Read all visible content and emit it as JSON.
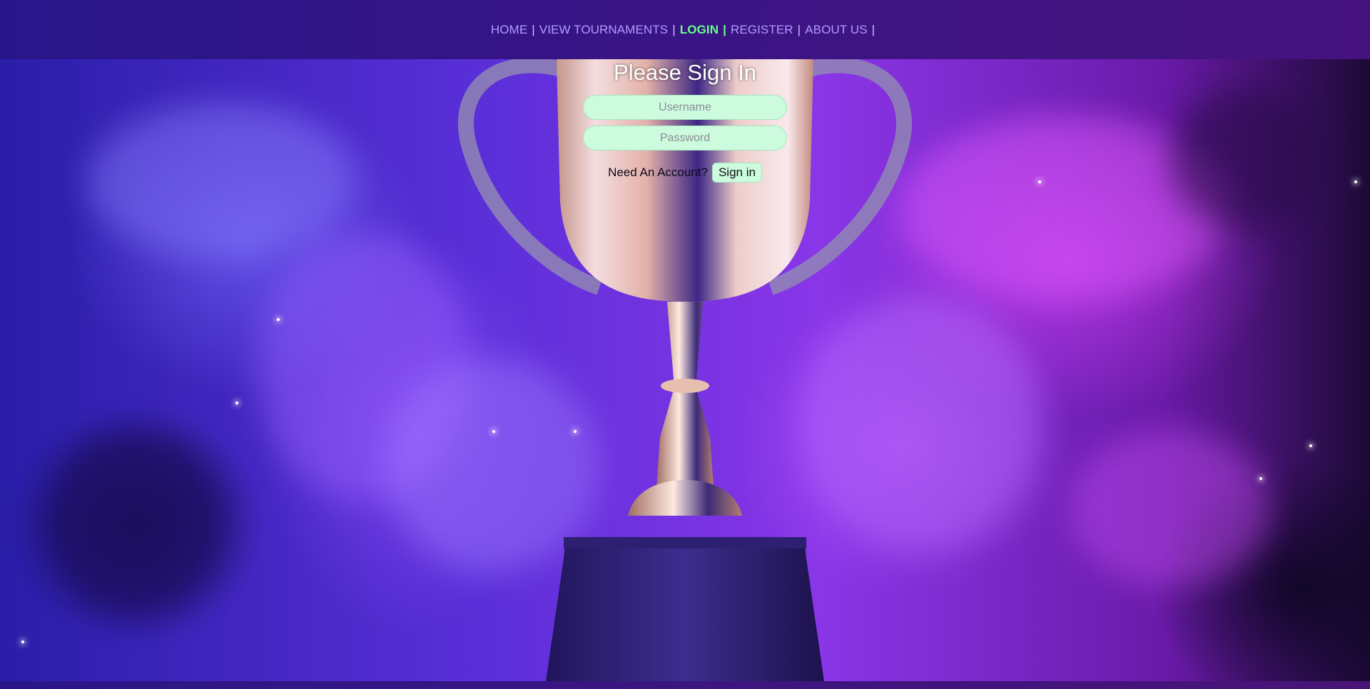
{
  "nav": {
    "items": [
      {
        "label": "HOME",
        "active": false
      },
      {
        "label": "VIEW TOURNAMENTS",
        "active": false
      },
      {
        "label": "LOGIN",
        "active": true
      },
      {
        "label": "REGISTER",
        "active": false
      },
      {
        "label": "ABOUT US",
        "active": false
      }
    ],
    "separator": "|",
    "link_color": "#b29cff",
    "active_color": "#66ff88"
  },
  "hero": {
    "image": "trophy-smoke-icon"
  },
  "login": {
    "title": "Please Sign In",
    "username_placeholder": "Username",
    "password_placeholder": "Password",
    "account_prompt": "Need An Account?",
    "signin_label": "Sign in",
    "field_color": "#ccfbde"
  }
}
